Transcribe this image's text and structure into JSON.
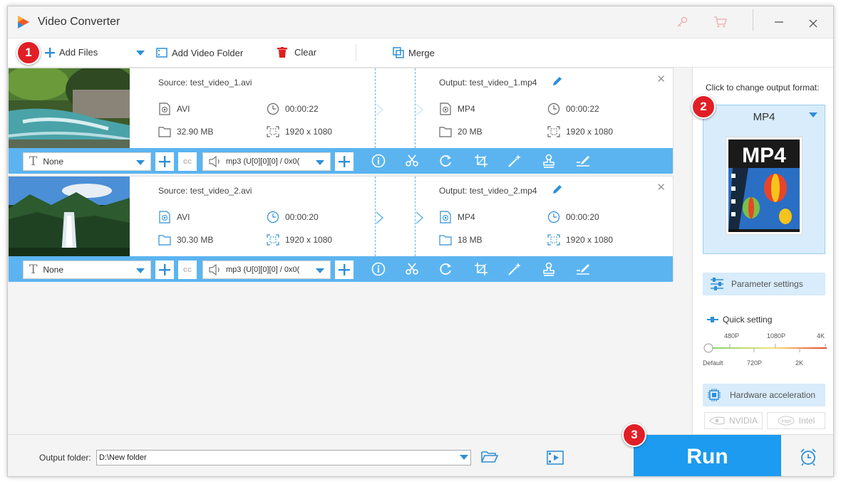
{
  "app": {
    "title": "Video Converter",
    "icon": "app-logo-icon"
  },
  "titlebar": {
    "icons": [
      "key-icon",
      "cart-icon",
      "minimize-icon",
      "close-icon"
    ]
  },
  "toolbar": {
    "add_files": "Add Files",
    "add_video_folder": "Add Video Folder",
    "clear": "Clear",
    "merge": "Merge"
  },
  "badges": [
    "1",
    "2",
    "3"
  ],
  "items": [
    {
      "source": "Source: test_video_1.avi",
      "output": "Output: test_video_1.mp4",
      "src_format": "AVI",
      "src_duration": "00:00:22",
      "src_size": "32.90 MB",
      "src_resolution": "1920 x 1080",
      "out_format": "MP4",
      "out_duration": "00:00:22",
      "out_size": "20 MB",
      "out_resolution": "1920 x 1080",
      "subtitle": "None",
      "audio": "mp3 (U[0][0][0] / 0x0("
    },
    {
      "source": "Source: test_video_2.avi",
      "output": "Output: test_video_2.mp4",
      "src_format": "AVI",
      "src_duration": "00:00:20",
      "src_size": "30.30 MB",
      "src_resolution": "1920 x 1080",
      "out_format": "MP4",
      "out_duration": "00:00:20",
      "out_size": "18 MB",
      "out_resolution": "1920 x 1080",
      "subtitle": "None",
      "audio": "mp3 (U[0][0][0] / 0x0("
    }
  ],
  "right_panel": {
    "title": "Click to change output format:",
    "format": "MP4",
    "format_icon_label": "MP4",
    "parameter_settings": "Parameter settings",
    "quick_setting": "Quick setting",
    "slider_top_labels": [
      "480P",
      "1080P",
      "4K"
    ],
    "slider_bottom_labels": [
      "Default",
      "720P",
      "2K"
    ],
    "slider_value": "Default",
    "hardware_acceleration": "Hardware acceleration",
    "nvidia": "NVIDIA",
    "intel": "Intel"
  },
  "bottom": {
    "output_folder_label": "Output folder:",
    "output_folder_value": "D:\\New folder",
    "run": "Run"
  },
  "colors": {
    "accent": "#1d9bf0",
    "bar": "#5bb4f0",
    "badge": "#e21e26",
    "panel": "#d8ecfb"
  }
}
